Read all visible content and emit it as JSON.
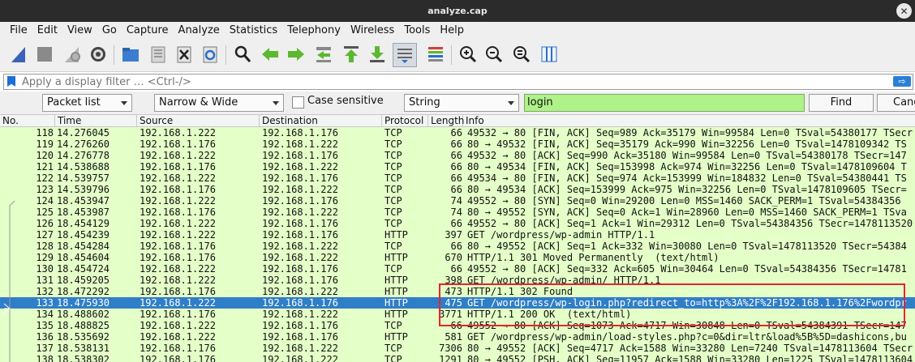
{
  "window": {
    "title": "analyze.cap",
    "close_glyph": "✕"
  },
  "menu": [
    "File",
    "Edit",
    "View",
    "Go",
    "Capture",
    "Analyze",
    "Statistics",
    "Telephony",
    "Wireless",
    "Tools",
    "Help"
  ],
  "filter": {
    "placeholder": "Apply a display filter … <Ctrl-/>",
    "apply_glyph": "⇨"
  },
  "search": {
    "scope": "Packet list",
    "charset": "Narrow & Wide",
    "case_sensitive_label": "Case sensitive",
    "type": "String",
    "query": "login",
    "find_label": "Find",
    "cancel_label": "Canc"
  },
  "columns": [
    "No.",
    "Time",
    "Source",
    "Destination",
    "Protocol",
    "Length",
    "Info"
  ],
  "packets": [
    {
      "no": "118",
      "time": "14.276045",
      "src": "192.168.1.222",
      "dst": "192.168.1.176",
      "proto": "TCP",
      "len": "66",
      "info": "49532 → 80 [FIN, ACK] Seq=989 Ack=35179 Win=99584 Len=0 TSval=54380177 TSecr"
    },
    {
      "no": "119",
      "time": "14.276260",
      "src": "192.168.1.176",
      "dst": "192.168.1.222",
      "proto": "TCP",
      "len": "66",
      "info": "80 → 49532 [FIN, ACK] Seq=35179 Ack=990 Win=32256 Len=0 TSval=1478109342 TS"
    },
    {
      "no": "120",
      "time": "14.276778",
      "src": "192.168.1.222",
      "dst": "192.168.1.176",
      "proto": "TCP",
      "len": "66",
      "info": "49532 → 80 [ACK] Seq=990 Ack=35180 Win=99584 Len=0 TSval=54380178 TSecr=147"
    },
    {
      "no": "121",
      "time": "14.538688",
      "src": "192.168.1.176",
      "dst": "192.168.1.222",
      "proto": "TCP",
      "len": "66",
      "info": "80 → 49534 [FIN, ACK] Seq=153998 Ack=974 Win=32256 Len=0 TSval=1478109604 T"
    },
    {
      "no": "122",
      "time": "14.539757",
      "src": "192.168.1.222",
      "dst": "192.168.1.176",
      "proto": "TCP",
      "len": "66",
      "info": "49534 → 80 [FIN, ACK] Seq=974 Ack=153999 Win=184832 Len=0 TSval=54380441 TS"
    },
    {
      "no": "123",
      "time": "14.539796",
      "src": "192.168.1.176",
      "dst": "192.168.1.222",
      "proto": "TCP",
      "len": "66",
      "info": "80 → 49534 [ACK] Seq=153999 Ack=975 Win=32256 Len=0 TSval=1478109605 TSecr="
    },
    {
      "no": "124",
      "time": "18.453947",
      "src": "192.168.1.222",
      "dst": "192.168.1.176",
      "proto": "TCP",
      "len": "74",
      "info": "49552 → 80 [SYN] Seq=0 Win=29200 Len=0 MSS=1460 SACK_PERM=1 TSval=54384356"
    },
    {
      "no": "125",
      "time": "18.453987",
      "src": "192.168.1.176",
      "dst": "192.168.1.222",
      "proto": "TCP",
      "len": "74",
      "info": "80 → 49552 [SYN, ACK] Seq=0 Ack=1 Win=28960 Len=0 MSS=1460 SACK_PERM=1 TSva"
    },
    {
      "no": "126",
      "time": "18.454129",
      "src": "192.168.1.222",
      "dst": "192.168.1.176",
      "proto": "TCP",
      "len": "66",
      "info": "49552 → 80 [ACK] Seq=1 Ack=1 Win=29312 Len=0 TSval=54384356 TSecr=1478113520"
    },
    {
      "no": "127",
      "time": "18.454239",
      "src": "192.168.1.222",
      "dst": "192.168.1.176",
      "proto": "HTTP",
      "len": "397",
      "info": "GET /wordpress/wp-admin HTTP/1.1"
    },
    {
      "no": "128",
      "time": "18.454284",
      "src": "192.168.1.176",
      "dst": "192.168.1.222",
      "proto": "TCP",
      "len": "66",
      "info": "80 → 49552 [ACK] Seq=1 Ack=332 Win=30080 Len=0 TSval=1478113520 TSecr=54384"
    },
    {
      "no": "129",
      "time": "18.454604",
      "src": "192.168.1.176",
      "dst": "192.168.1.222",
      "proto": "HTTP",
      "len": "670",
      "info": "HTTP/1.1 301 Moved Permanently  (text/html)"
    },
    {
      "no": "130",
      "time": "18.454724",
      "src": "192.168.1.222",
      "dst": "192.168.1.176",
      "proto": "TCP",
      "len": "66",
      "info": "49552 → 80 [ACK] Seq=332 Ack=605 Win=30464 Len=0 TSval=54384356 TSecr=14781"
    },
    {
      "no": "131",
      "time": "18.459205",
      "src": "192.168.1.222",
      "dst": "192.168.1.176",
      "proto": "HTTP",
      "len": "398",
      "info": "GET /wordpress/wp-admin/ HTTP/1.1"
    },
    {
      "no": "132",
      "time": "18.472292",
      "src": "192.168.1.176",
      "dst": "192.168.1.222",
      "proto": "HTTP",
      "len": "473",
      "info": "HTTP/1.1 302 Found"
    },
    {
      "no": "133",
      "time": "18.475930",
      "src": "192.168.1.222",
      "dst": "192.168.1.176",
      "proto": "HTTP",
      "len": "475",
      "info": "GET /wordpress/wp-login.php?redirect_to=http%3A%2F%2F192.168.1.176%2Fwordpr"
    },
    {
      "no": "134",
      "time": "18.488602",
      "src": "192.168.1.176",
      "dst": "192.168.1.222",
      "proto": "HTTP",
      "len": "3771",
      "info": "HTTP/1.1 200 OK  (text/html)"
    },
    {
      "no": "135",
      "time": "18.488825",
      "src": "192.168.1.222",
      "dst": "192.168.1.176",
      "proto": "TCP",
      "len": "66",
      "info": "49552 → 80 [ACK] Seq=1073 Ack=4717 Win=30848 Len=0 TSval=54384391 TSecr=147"
    },
    {
      "no": "136",
      "time": "18.535692",
      "src": "192.168.1.222",
      "dst": "192.168.1.176",
      "proto": "HTTP",
      "len": "581",
      "info": "GET /wordpress/wp-admin/load-styles.php?c=0&dir=ltr&load%5B%5D=dashicons,bu"
    },
    {
      "no": "137",
      "time": "18.538131",
      "src": "192.168.1.176",
      "dst": "192.168.1.222",
      "proto": "TCP",
      "len": "7306",
      "info": "80 → 49552 [ACK] Seq=4717 Ack=1588 Win=33280 Len=7240 TSval=1478113604 TSecr"
    },
    {
      "no": "138",
      "time": "18.538302",
      "src": "192.168.1.176",
      "dst": "192.168.1.222",
      "proto": "TCP",
      "len": "1291",
      "info": "80 → 49552 [PSH, ACK] Seq=11957 Ack=1588 Win=33280 Len=1225 TSval=1478113604"
    }
  ],
  "selected_packet": "133",
  "colors": {
    "tcp_row": "#e4ffc7",
    "selected_row": "#2f7ec8",
    "search_field": "#aff28a",
    "highlight_box": "#e3262e"
  }
}
